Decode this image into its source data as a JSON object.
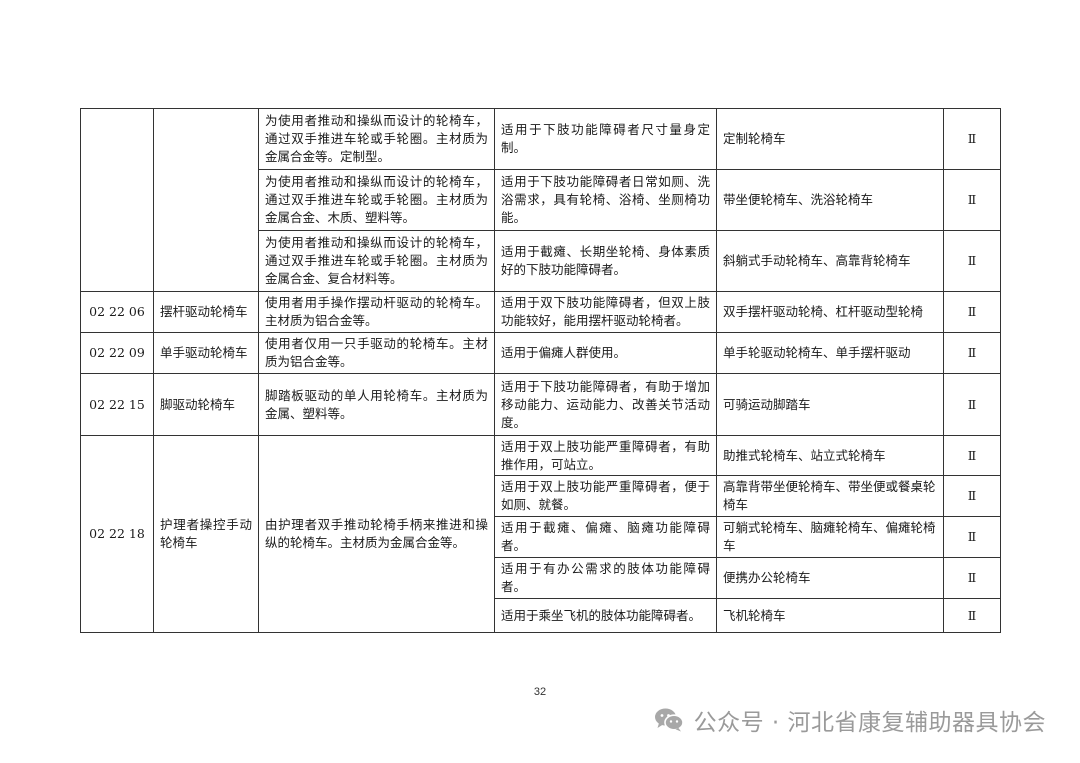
{
  "table": {
    "top_rows": [
      {
        "description": "为使用者推动和操纵而设计的轮椅车，通过双手推进车轮或手轮圈。主材质为金属合金等。定制型。",
        "usage": "适用于下肢功能障碍者尺寸量身定制。",
        "examples": "定制轮椅车",
        "class": "Ⅱ"
      },
      {
        "description": "为使用者推动和操纵而设计的轮椅车，通过双手推进车轮或手轮圈。主材质为金属合金、木质、塑料等。",
        "usage": "适用于下肢功能障碍者日常如厕、洗浴需求，具有轮椅、浴椅、坐厕椅功能。",
        "examples": "带坐便轮椅车、洗浴轮椅车",
        "class": "Ⅱ"
      },
      {
        "description": "为使用者推动和操纵而设计的轮椅车，通过双手推进车轮或手轮圈。主材质为金属合金、复合材料等。",
        "usage": "适用于截瘫、长期坐轮椅、身体素质好的下肢功能障碍者。",
        "examples": "斜躺式手动轮椅车、高靠背轮椅车",
        "class": "Ⅱ"
      }
    ],
    "mid_rows": [
      {
        "code": "02 22 06",
        "name": "摆杆驱动轮椅车",
        "description": "使用者用手操作摆动杆驱动的轮椅车。主材质为铝合金等。",
        "usage": "适用于双下肢功能障碍者，但双上肢功能较好，能用摆杆驱动轮椅者。",
        "examples": "双手摆杆驱动轮椅、杠杆驱动型轮椅",
        "class": "Ⅱ"
      },
      {
        "code": "02 22 09",
        "name": "单手驱动轮椅车",
        "description": "使用者仅用一只手驱动的轮椅车。主材质为铝合金等。",
        "usage": "适用于偏瘫人群使用。",
        "examples": "单手轮驱动轮椅车、单手摆杆驱动",
        "class": "Ⅱ"
      },
      {
        "code": "02 22 15",
        "name": "脚驱动轮椅车",
        "description": "脚踏板驱动的单人用轮椅车。主材质为金属、塑料等。",
        "usage": "适用于下肢功能障碍者，有助于增加移动能力、运动能力、改善关节活动度。",
        "examples": "可骑运动脚踏车",
        "class": "Ⅱ"
      }
    ],
    "attendant_group": {
      "code": "02 22 18",
      "name": "护理者操控手动轮椅车",
      "description": "由护理者双手推动轮椅手柄来推进和操纵的轮椅车。主材质为金属合金等。",
      "rows": [
        {
          "usage": "适用于双上肢功能严重障碍者，有助推作用，可站立。",
          "examples": "助推式轮椅车、站立式轮椅车",
          "class": "Ⅱ"
        },
        {
          "usage": "适用于双上肢功能严重障碍者，便于如厕、就餐。",
          "examples": "高靠背带坐便轮椅车、带坐便或餐桌轮椅车",
          "class": "Ⅱ"
        },
        {
          "usage": "适用于截瘫、偏瘫、脑瘫功能障碍者。",
          "examples": "可躺式轮椅车、脑瘫轮椅车、偏瘫轮椅车",
          "class": "Ⅱ"
        },
        {
          "usage": "适用于有办公需求的肢体功能障碍者。",
          "examples": "便携办公轮椅车",
          "class": "Ⅱ"
        },
        {
          "usage": "适用于乘坐飞机的肢体功能障碍者。",
          "examples": "飞机轮椅车",
          "class": "Ⅱ"
        }
      ]
    }
  },
  "footer": {
    "page_number": "32"
  },
  "watermark": {
    "icon": "wechat-icon",
    "text": "公众号 · 河北省康复辅助器具协会",
    "color": "#9a9a9a"
  }
}
